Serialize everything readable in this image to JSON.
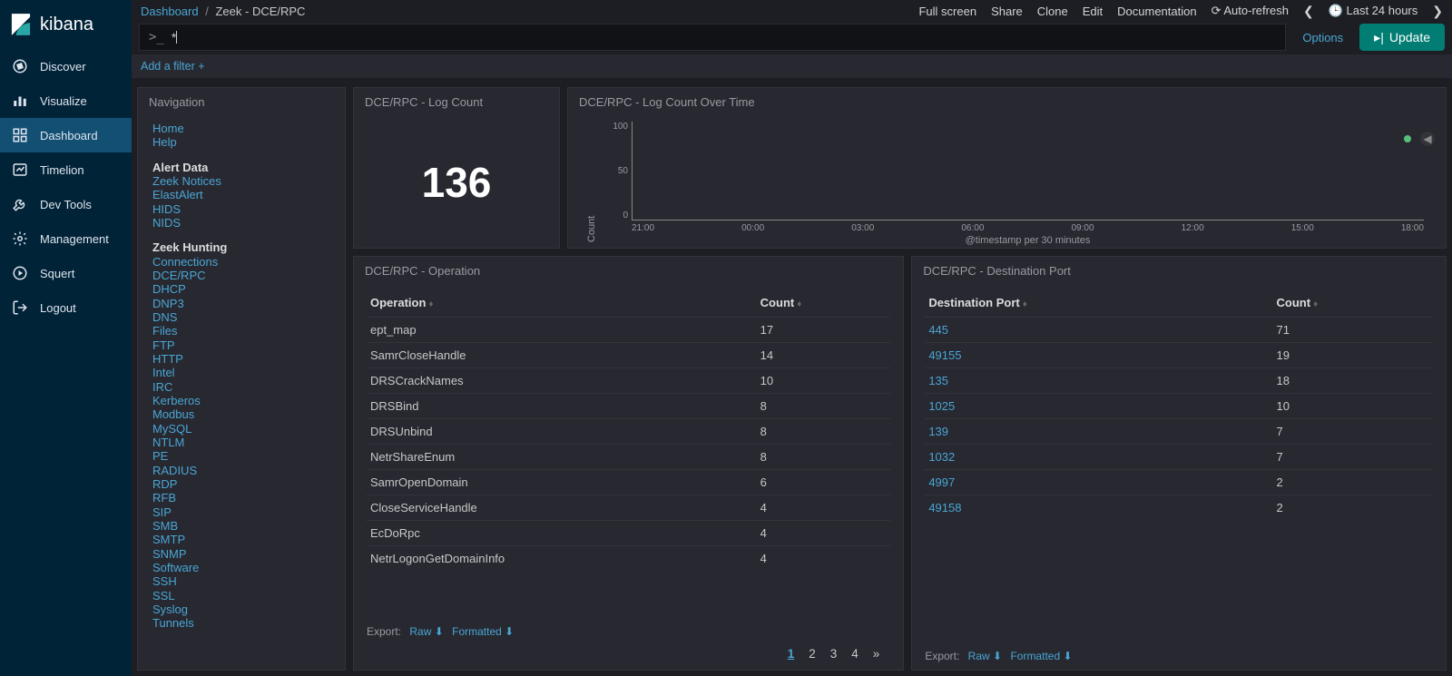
{
  "brand": "kibana",
  "sidebar_nav": [
    {
      "id": "discover",
      "label": "Discover"
    },
    {
      "id": "visualize",
      "label": "Visualize"
    },
    {
      "id": "dashboard",
      "label": "Dashboard",
      "active": true
    },
    {
      "id": "timelion",
      "label": "Timelion"
    },
    {
      "id": "devtools",
      "label": "Dev Tools"
    },
    {
      "id": "management",
      "label": "Management"
    },
    {
      "id": "squert",
      "label": "Squert"
    },
    {
      "id": "logout",
      "label": "Logout"
    }
  ],
  "breadcrumb": {
    "root": "Dashboard",
    "sep": "/",
    "current": "Zeek - DCE/RPC"
  },
  "top_actions": {
    "full_screen": "Full screen",
    "share": "Share",
    "clone": "Clone",
    "edit": "Edit",
    "documentation": "Documentation",
    "auto_refresh": "Auto-refresh",
    "time_range": "Last 24 hours"
  },
  "query": {
    "prompt": ">_",
    "value": "*"
  },
  "options_label": "Options",
  "update_label": "Update",
  "add_filter": "Add a filter",
  "nav_panel": {
    "title": "Navigation",
    "basic": [
      "Home",
      "Help"
    ],
    "alert_heading": "Alert Data",
    "alert_links": [
      "Zeek Notices",
      "ElastAlert",
      "HIDS",
      "NIDS"
    ],
    "hunt_heading": "Zeek Hunting",
    "hunt_links": [
      "Connections",
      "DCE/RPC",
      "DHCP",
      "DNP3",
      "DNS",
      "Files",
      "FTP",
      "HTTP",
      "Intel",
      "IRC",
      "Kerberos",
      "Modbus",
      "MySQL",
      "NTLM",
      "PE",
      "RADIUS",
      "RDP",
      "RFB",
      "SIP",
      "SMB",
      "SMTP",
      "SNMP",
      "Software",
      "SSH",
      "SSL",
      "Syslog",
      "Tunnels"
    ]
  },
  "metric_panel": {
    "title": "DCE/RPC - Log Count",
    "value": "136"
  },
  "chart_data": {
    "type": "bar",
    "title": "DCE/RPC - Log Count Over Time",
    "ylabel": "Count",
    "xlabel": "@timestamp per 30 minutes",
    "ylim": [
      0,
      100
    ],
    "yticks": [
      0,
      50,
      100
    ],
    "categories": [
      "21:00",
      "00:00",
      "03:00",
      "06:00",
      "09:00",
      "12:00",
      "15:00",
      "18:00"
    ],
    "values": [
      0,
      0,
      0,
      0,
      0,
      0,
      0,
      0
    ]
  },
  "operation_panel": {
    "title": "DCE/RPC - Operation",
    "columns": [
      "Operation",
      "Count"
    ],
    "rows": [
      {
        "op": "ept_map",
        "count": 17
      },
      {
        "op": "SamrCloseHandle",
        "count": 14
      },
      {
        "op": "DRSCrackNames",
        "count": 10
      },
      {
        "op": "DRSBind",
        "count": 8
      },
      {
        "op": "DRSUnbind",
        "count": 8
      },
      {
        "op": "NetrShareEnum",
        "count": 8
      },
      {
        "op": "SamrOpenDomain",
        "count": 6
      },
      {
        "op": "CloseServiceHandle",
        "count": 4
      },
      {
        "op": "EcDoRpc",
        "count": 4
      },
      {
        "op": "NetrLogonGetDomainInfo",
        "count": 4
      }
    ],
    "export_label": "Export:",
    "raw": "Raw",
    "formatted": "Formatted",
    "pages": [
      "1",
      "2",
      "3",
      "4",
      "»"
    ],
    "active_page": "1"
  },
  "destport_panel": {
    "title": "DCE/RPC - Destination Port",
    "columns": [
      "Destination Port",
      "Count"
    ],
    "rows": [
      {
        "port": "445",
        "count": 71
      },
      {
        "port": "49155",
        "count": 19
      },
      {
        "port": "135",
        "count": 18
      },
      {
        "port": "1025",
        "count": 10
      },
      {
        "port": "139",
        "count": 7
      },
      {
        "port": "1032",
        "count": 7
      },
      {
        "port": "4997",
        "count": 2
      },
      {
        "port": "49158",
        "count": 2
      }
    ],
    "export_label": "Export:",
    "raw": "Raw",
    "formatted": "Formatted"
  }
}
